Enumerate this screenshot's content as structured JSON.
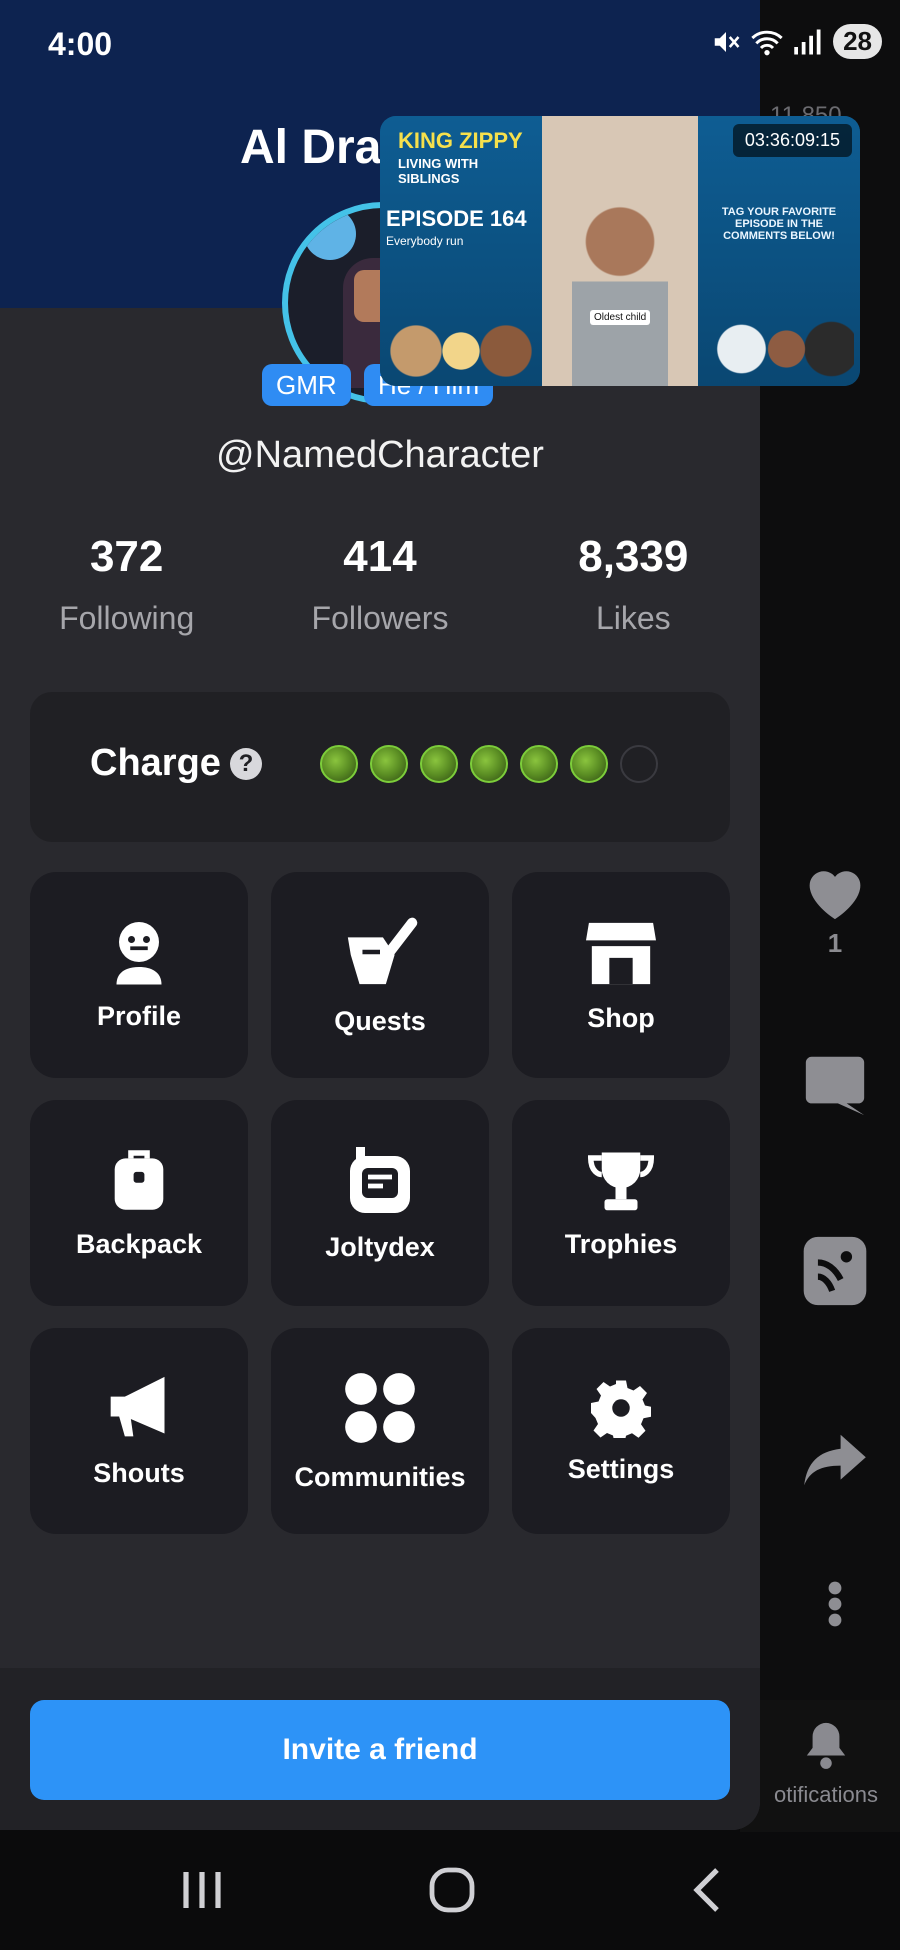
{
  "status_bar": {
    "time": "4:00",
    "battery": "28",
    "icons": [
      "mute-icon",
      "wifi-icon",
      "signal-icon"
    ]
  },
  "background_app": {
    "count": "11,850",
    "like_count": "1",
    "bottom_nav_label": "otifications"
  },
  "drawer": {
    "title": "Al Dra",
    "badges": {
      "gmr": "GMR",
      "pronouns": "He / Him"
    },
    "username": "@NamedCharacter",
    "stats": [
      {
        "value": "372",
        "label": "Following"
      },
      {
        "value": "414",
        "label": "Followers"
      },
      {
        "value": "8,339",
        "label": "Likes"
      }
    ],
    "charge": {
      "label": "Charge",
      "filled": 6,
      "total": 7
    },
    "menu": [
      {
        "label": "Profile",
        "icon": "profile-icon"
      },
      {
        "label": "Quests",
        "icon": "quests-icon"
      },
      {
        "label": "Shop",
        "icon": "shop-icon"
      },
      {
        "label": "Backpack",
        "icon": "backpack-icon"
      },
      {
        "label": "Joltydex",
        "icon": "joltydex-icon"
      },
      {
        "label": "Trophies",
        "icon": "trophy-icon"
      },
      {
        "label": "Shouts",
        "icon": "megaphone-icon"
      },
      {
        "label": "Communities",
        "icon": "communities-icon"
      },
      {
        "label": "Settings",
        "icon": "gear-icon"
      }
    ],
    "invite_label": "Invite a friend"
  },
  "video": {
    "brand": "KING ZIPPY",
    "subtitle": "LIVING WITH SIBLINGS",
    "episode": "EPISODE 164",
    "episode_subtitle": "Everybody run",
    "caption": "Oldest child",
    "timer": "03:36:09:15",
    "cta": "TAG YOUR FAVORITE EPISODE IN THE COMMENTS BELOW!"
  },
  "colors": {
    "accent": "#2d93f7",
    "drawer_bg": "#29292e",
    "header_bg": "#0d2350",
    "charge_green": "#7ccd3a"
  }
}
